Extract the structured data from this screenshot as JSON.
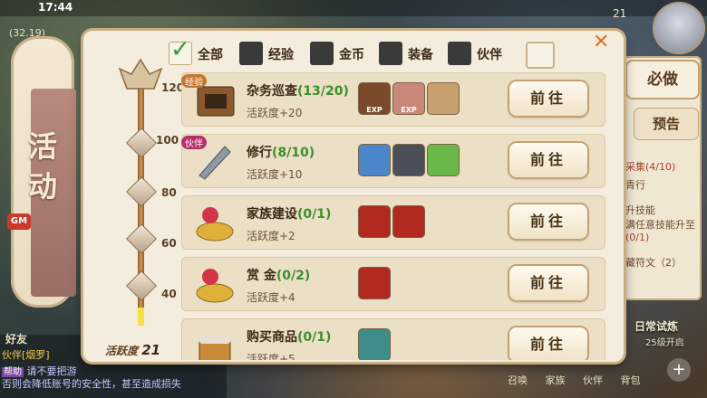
{
  "status": {
    "time": "17:44",
    "level": "(32.19)",
    "top_right_num": "21"
  },
  "banner": {
    "title": "活动",
    "gm": "GM"
  },
  "chat": {
    "friend_label": "好友",
    "channel": "伙伴[烟罗]",
    "channel_tag": "帮助",
    "warning1": "请不要把游",
    "warning2": "否则会降低账号的安全性，甚至造成损失"
  },
  "bottom_menu": [
    "召唤",
    "家族",
    "伙伴",
    "背包"
  ],
  "filters": [
    {
      "label": "全部",
      "checked": true
    },
    {
      "label": "经验",
      "checked": false
    },
    {
      "label": "金币",
      "checked": false
    },
    {
      "label": "装备",
      "checked": false
    },
    {
      "label": "伙伴",
      "checked": false
    }
  ],
  "progress": {
    "marks": [
      "120",
      "100",
      "80",
      "60",
      "40"
    ],
    "activity_label": "活跃度",
    "activity_value": "21",
    "fraction": 0.175
  },
  "tasks": [
    {
      "tag": "经验",
      "tag_color": "#c7742e",
      "name": "杂务巡查",
      "count": "(13/20)",
      "activity": "活跃度+20",
      "go": "前往",
      "rewards": [
        {
          "icon": "exp-character-icon",
          "text": "EXP",
          "color": "#7a4a2a"
        },
        {
          "icon": "exp-pig-icon",
          "text": "EXP",
          "color": "#c9887a"
        },
        {
          "icon": "map-scroll-icon",
          "text": "",
          "color": "#c8a070"
        }
      ]
    },
    {
      "tag": "伙伴",
      "tag_color": "#b5306a",
      "name": "修行",
      "count": "(8/10)",
      "activity": "活跃度+10",
      "go": "前往",
      "rewards": [
        {
          "icon": "ice-crystal-icon",
          "text": "",
          "color": "#4d86c8"
        },
        {
          "icon": "dark-ore-icon",
          "text": "",
          "color": "#4a4f5a"
        },
        {
          "icon": "green-feather-icon",
          "text": "",
          "color": "#6ab84a"
        }
      ]
    },
    {
      "tag": "",
      "tag_color": "",
      "name": "家族建设",
      "count": "(0/1)",
      "activity": "活跃度+2",
      "go": "前往",
      "rewards": [
        {
          "icon": "red-envelope-icon",
          "text": "",
          "color": "#b22a1f"
        },
        {
          "icon": "red-ticket-icon",
          "text": "",
          "color": "#b22a1f"
        }
      ]
    },
    {
      "tag": "",
      "tag_color": "",
      "name": "赏 金",
      "count": "(0/2)",
      "activity": "活跃度+4",
      "go": "前往",
      "rewards": [
        {
          "icon": "red-envelope-icon",
          "text": "",
          "color": "#b22a1f"
        }
      ]
    },
    {
      "tag": "",
      "tag_color": "",
      "name": "购买商品",
      "count": "(0/1)",
      "activity": "活跃度+5",
      "go": "前往",
      "rewards": [
        {
          "icon": "jade-orb-icon",
          "text": "",
          "color": "#3f8d8a"
        }
      ]
    }
  ],
  "side": {
    "must": "必做",
    "preview": "预告",
    "lines": [
      "采集(4/10)",
      "青行",
      "升技能",
      "满任意技能升至",
      "(0/1)",
      "藏符文（2）"
    ],
    "daily": "日常试炼",
    "daily_sub": "25级开启"
  }
}
